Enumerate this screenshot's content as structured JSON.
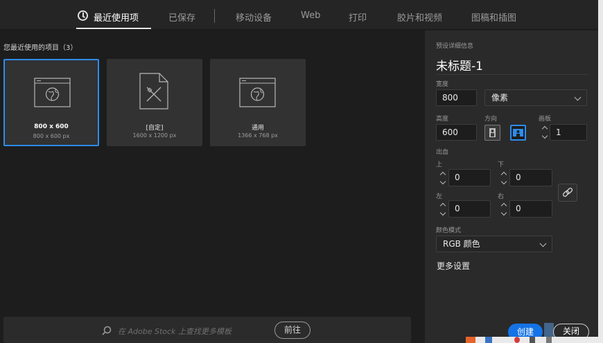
{
  "nav": {
    "tabs": [
      {
        "label": "最近使用项",
        "active": true
      },
      {
        "label": "已保存"
      },
      {
        "label": "移动设备"
      },
      {
        "label": "Web"
      },
      {
        "label": "打印"
      },
      {
        "label": "胶片和视频"
      },
      {
        "label": "图稿和插图"
      }
    ]
  },
  "recent": {
    "title": "您最近使用的项目（3）",
    "items": [
      {
        "name": "800 x 600",
        "size": "800 x 600 px",
        "icon": "web-icon",
        "selected": true
      },
      {
        "name": "[自定]",
        "size": "1600 x 1200 px",
        "icon": "custom-icon",
        "selected": false
      },
      {
        "name": "通用",
        "size": "1366 x 768 px",
        "icon": "web-icon",
        "selected": false
      }
    ]
  },
  "search": {
    "placeholder": "在 Adobe Stock 上查找更多模板",
    "go_label": "前往"
  },
  "details": {
    "header": "预设详细信息",
    "doc_name": "未标题-1",
    "width_label": "宽度",
    "width_value": "800",
    "unit": "像素",
    "height_label": "高度",
    "height_value": "600",
    "orientation_label": "方向",
    "artboard_label": "画板",
    "artboard_value": "1",
    "bleed_label": "出血",
    "top_label": "上",
    "top_value": "0",
    "bottom_label": "下",
    "bottom_value": "0",
    "left_label": "左",
    "left_value": "0",
    "right_label": "右",
    "right_value": "0",
    "color_mode_label": "颜色模式",
    "color_mode_value": "RGB 颜色",
    "more_settings": "更多设置",
    "create": "创建",
    "close": "关闭"
  },
  "colors": {
    "accent": "#2d8ceb",
    "primary_button": "#1473e6",
    "panel": "#2a2a2a",
    "background": "#1d1d1d"
  }
}
